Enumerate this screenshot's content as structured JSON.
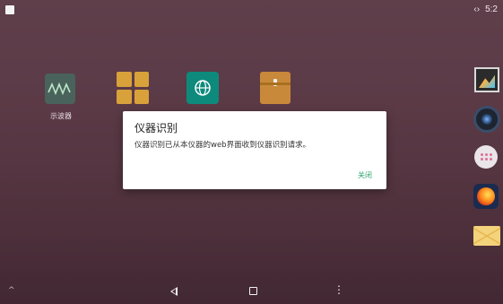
{
  "status_bar": {
    "connection_icon": "arrows-icon",
    "connection_glyph": "‹›",
    "time": "5:2"
  },
  "desktop": {
    "apps": [
      {
        "name": "waveform-app",
        "label": "示波器"
      },
      {
        "name": "grid-app",
        "label": ""
      },
      {
        "name": "globe-app",
        "label": ""
      },
      {
        "name": "archive-app",
        "label": ""
      }
    ]
  },
  "dock": [
    {
      "icon": "gallery-icon"
    },
    {
      "icon": "camera-icon"
    },
    {
      "icon": "apps-icon"
    },
    {
      "icon": "firefox-icon"
    },
    {
      "icon": "mail-icon"
    }
  ],
  "dialog": {
    "title": "仪器识别",
    "message": "仪器识别已从本仪器的web界面收到仪器识别请求。",
    "close_label": "关闭",
    "accent_color": "#2aa36b"
  },
  "navbar": {
    "caret_glyph": "^",
    "menu_glyph": "⋮"
  }
}
